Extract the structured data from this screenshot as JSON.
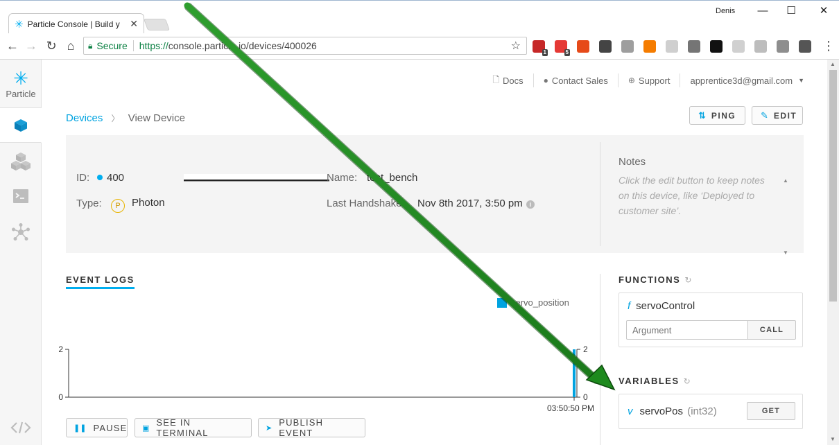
{
  "browser": {
    "tab_title": "Particle Console | Build y",
    "window_user": "Denis",
    "secure_label": "Secure",
    "url_scheme": "https://",
    "url_rest": "console.particle.io/devices/400026",
    "extensions": [
      {
        "name": "ext-red-badge",
        "color": "#c62828",
        "badge": "1"
      },
      {
        "name": "ext-opera",
        "color": "#e53935",
        "badge": "5"
      },
      {
        "name": "ext-e",
        "color": "#e64a19",
        "badge": ""
      },
      {
        "name": "ext-pocket",
        "color": "#444444",
        "badge": ""
      },
      {
        "name": "ext-gl",
        "color": "#9e9e9e",
        "badge": ""
      },
      {
        "name": "ext-orange",
        "color": "#f57c00",
        "badge": ""
      },
      {
        "name": "ext-grey-circle",
        "color": "#cfcfcf",
        "badge": ""
      },
      {
        "name": "ext-paw",
        "color": "#757575",
        "badge": ""
      },
      {
        "name": "ext-jb",
        "color": "#111111",
        "badge": ""
      },
      {
        "name": "ext-cookie",
        "color": "#d0d0d0",
        "badge": ""
      },
      {
        "name": "ext-shield",
        "color": "#bdbdbd",
        "badge": ""
      },
      {
        "name": "ext-v",
        "color": "#8e8e8e",
        "badge": ""
      },
      {
        "name": "ext-w",
        "color": "#555555",
        "badge": ""
      }
    ]
  },
  "sidebar": {
    "logo_text": "Particle"
  },
  "toplinks": {
    "docs": "Docs",
    "contact_sales": "Contact Sales",
    "support": "Support",
    "account": "apprentice3d@gmail.com"
  },
  "breadcrumb": {
    "devices": "Devices",
    "current": "View Device"
  },
  "actions": {
    "ping": "PING",
    "edit": "EDIT"
  },
  "device": {
    "id_label": "ID:",
    "id_value": "400",
    "type_label": "Type:",
    "type_icon": "P",
    "type_value": "Photon",
    "name_label": "Name:",
    "name_value": "test_bench",
    "handshake_label": "Last Handshake:",
    "handshake_value": "Nov 8th 2017, 3:50 pm"
  },
  "notes": {
    "title": "Notes",
    "placeholder": "Click the edit button to keep notes on this device, like ‘Deployed to customer site’."
  },
  "event_logs": {
    "heading": "EVENT LOGS",
    "pause": "PAUSE",
    "see_in_terminal": "SEE IN TERMINAL",
    "publish_event": "PUBLISH EVENT"
  },
  "chart_data": {
    "type": "bar",
    "series": [
      {
        "name": "servo_position",
        "color": "#00a3e0",
        "points": [
          {
            "x": "03:50:50 PM",
            "y": 2
          }
        ]
      }
    ],
    "x_tick_labels": [
      "03:50:50 PM"
    ],
    "y_left_ticks": [
      0,
      2
    ],
    "y_right_ticks": [
      0,
      2
    ],
    "ylim": [
      0,
      2
    ],
    "legend_position": "top-right",
    "grid": false
  },
  "functions": {
    "title": "FUNCTIONS",
    "items": [
      {
        "icon": "f",
        "name": "servoControl",
        "arg_placeholder": "Argument",
        "call_label": "CALL"
      }
    ]
  },
  "variables": {
    "title": "VARIABLES",
    "items": [
      {
        "icon": "v",
        "name": "servoPos",
        "type": "(int32)",
        "get_label": "GET"
      }
    ]
  },
  "colors": {
    "accent": "#00a3e0",
    "annotation_arrow": "#1f8a1f"
  }
}
